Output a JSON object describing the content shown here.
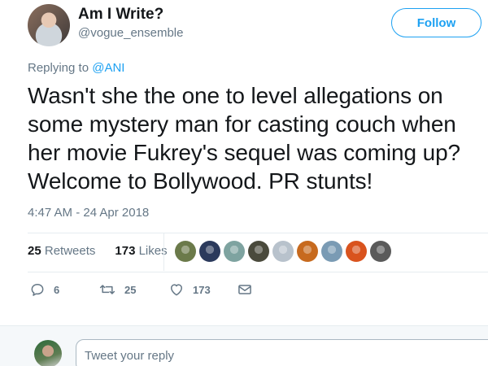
{
  "author": {
    "display_name": "Am I Write?",
    "handle": "@vogue_ensemble"
  },
  "follow_label": "Follow",
  "replying_to": {
    "prefix": "Replying to",
    "mention": "@ANI"
  },
  "tweet": {
    "line1": "Wasn't she the one to level allegations on",
    "line2": "some mystery man for casting couch when",
    "line3": "her movie Fukrey's sequel was coming up?",
    "line4": "Welcome to Bollywood. PR stunts!"
  },
  "timestamp": "4:47 AM - 24 Apr 2018",
  "stats": {
    "retweets_count": "25",
    "retweets_label": "Retweets",
    "likes_count": "173",
    "likes_label": "Likes"
  },
  "liker_avatar_colors": [
    "#6b7a4a",
    "#2b3a5c",
    "#7ea3a0",
    "#4a4a3c",
    "#b8c2cc",
    "#c76a1e",
    "#7a9bb4",
    "#d9531e",
    "#5a5a5a"
  ],
  "actions": {
    "reply_count": "6",
    "retweet_count": "25",
    "like_count": "173"
  },
  "reply_placeholder": "Tweet your reply",
  "colors": {
    "accent": "#1da1f2",
    "secondary_text": "#657786"
  }
}
